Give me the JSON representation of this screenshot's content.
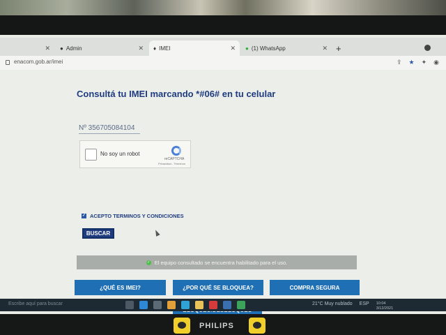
{
  "browser": {
    "tabs": [
      {
        "label": "",
        "close": "✕"
      },
      {
        "label": "Admin",
        "close": "✕"
      },
      {
        "label": "IMEI",
        "close": "✕"
      },
      {
        "label": "(1) WhatsApp",
        "close": "✕"
      }
    ],
    "new_tab": "+",
    "url": "enacom.gob.ar/imei"
  },
  "page": {
    "title": "Consultá tu IMEI marcando *#06# en tu celular",
    "imei_value": "Nº  356705084104",
    "captcha": {
      "label": "No soy un robot",
      "brand": "reCAPTCHA",
      "links": "Privacidad - Términos"
    },
    "terms_label": "ACEPTO TERMINOS Y CONDICIONES",
    "search_button": "BUSCAR",
    "status_message": "El equipo consultado se encuentra habilitado para el uso.",
    "buttons": {
      "que_es": "¿QUÉ ES IMEI?",
      "por_que": "¿POR QUÉ SE BLOQUEA?",
      "compra": "COMPRA SEGURA",
      "bloqueo": "BLOQUEO/DESBLOQUEO"
    }
  },
  "taskbar": {
    "search_placeholder": "Escribe aquí para buscar",
    "weather": "21°C  Muy nublado",
    "language": "ESP",
    "time": "10:04",
    "date": "3/12/2021"
  },
  "monitor": {
    "brand": "PHILIPS"
  },
  "colors": {
    "accent": "#1f3c80",
    "button": "#1f6fb5",
    "status_bg": "#a9ada9"
  }
}
